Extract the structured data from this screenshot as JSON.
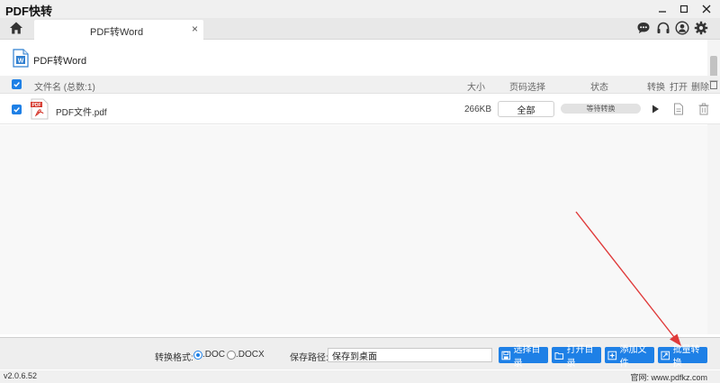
{
  "app": {
    "title": "PDF快转"
  },
  "tabs": [
    {
      "label": "PDF转Word",
      "close": "×"
    }
  ],
  "function": {
    "title": "PDF转Word"
  },
  "columns": {
    "name": "文件名 (总数:1)",
    "size": "大小",
    "pages": "页码选择",
    "status": "状态",
    "convert": "转换",
    "open": "打开",
    "delete": "删除"
  },
  "files": [
    {
      "name": "PDF文件.pdf",
      "size": "266KB",
      "pages": "全部",
      "status": "等待转换",
      "checked": true
    }
  ],
  "bottom": {
    "format_label": "转换格式:",
    "formats": [
      {
        "label": ".DOC",
        "selected": true
      },
      {
        "label": ".DOCX",
        "selected": false
      }
    ],
    "path_label": "保存路径:",
    "path_value": "保存到桌面",
    "buttons": {
      "select_dir": "选择目录",
      "open_dir": "打开目录",
      "add_file": "添加文件",
      "batch_convert": "批量转换"
    }
  },
  "footer": {
    "version": "v2.0.6.52",
    "website": "官网: www.pdfkz.com"
  },
  "colors": {
    "accent": "#1e80e6",
    "annotation_arrow": "#e03a3a"
  }
}
